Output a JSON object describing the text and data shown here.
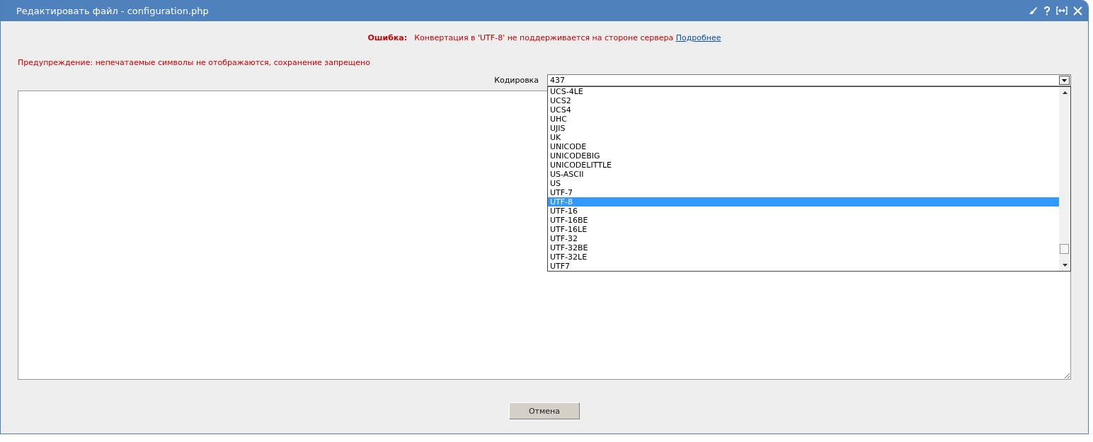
{
  "window": {
    "title": "Редактировать файл - configuration.php"
  },
  "error": {
    "label": "Ошибка:",
    "message": "Конвертация в 'UTF-8' не поддерживается на стороне сервера",
    "link": "Подробнее"
  },
  "warning": "Предупреждение: непечатаемые символы не отображаются, сохранение запрещено",
  "encoding": {
    "label": "Кодировка",
    "value": "437",
    "expanded": true,
    "options": [
      {
        "label": "UCS-4LE",
        "selected": false
      },
      {
        "label": "UCS2",
        "selected": false
      },
      {
        "label": "UCS4",
        "selected": false
      },
      {
        "label": "UHC",
        "selected": false
      },
      {
        "label": "UJIS",
        "selected": false
      },
      {
        "label": "UK",
        "selected": false
      },
      {
        "label": "UNICODE",
        "selected": false
      },
      {
        "label": "UNICODEBIG",
        "selected": false
      },
      {
        "label": "UNICODELITTLE",
        "selected": false
      },
      {
        "label": "US-ASCII",
        "selected": false
      },
      {
        "label": "US",
        "selected": false
      },
      {
        "label": "UTF-7",
        "selected": false
      },
      {
        "label": "UTF-8",
        "selected": true
      },
      {
        "label": "UTF-16",
        "selected": false
      },
      {
        "label": "UTF-16BE",
        "selected": false
      },
      {
        "label": "UTF-16LE",
        "selected": false
      },
      {
        "label": "UTF-32",
        "selected": false
      },
      {
        "label": "UTF-32BE",
        "selected": false
      },
      {
        "label": "UTF-32LE",
        "selected": false
      },
      {
        "label": "UTF7",
        "selected": false
      }
    ]
  },
  "buttons": [
    "Отмена"
  ]
}
